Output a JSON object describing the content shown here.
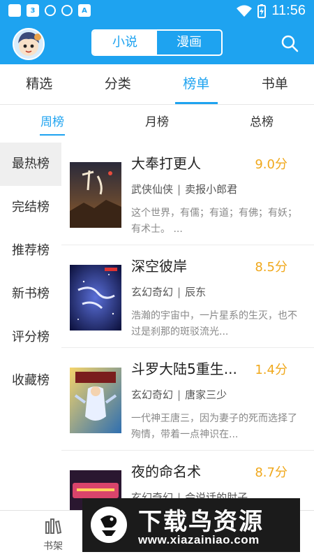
{
  "status_bar": {
    "time": "11:56",
    "icons": [
      "app-icon",
      "network-3g-icon",
      "shield-icon",
      "shield-check-icon",
      "font-a-icon",
      "wifi-icon",
      "battery-charging-icon"
    ]
  },
  "header": {
    "seg_novel": "小说",
    "seg_comic": "漫画",
    "active_segment": "小说"
  },
  "categories": [
    "精选",
    "分类",
    "榜单",
    "书单"
  ],
  "active_category": "榜单",
  "periods": [
    "周榜",
    "月榜",
    "总榜"
  ],
  "active_period": "周榜",
  "ranks": [
    "最热榜",
    "完结榜",
    "推荐榜",
    "新书榜",
    "评分榜",
    "收藏榜"
  ],
  "active_rank": "最热榜",
  "books": [
    {
      "title": "大奉打更人",
      "score": "9.0分",
      "genre": "武侠仙侠",
      "author": "卖报小郎君",
      "desc": "这个世界，有儒；有道；有佛；有妖；有术士。 ..."
    },
    {
      "title": "深空彼岸",
      "score": "8.5分",
      "genre": "玄幻奇幻",
      "author": "辰东",
      "desc": "浩瀚的宇宙中，一片星系的生灭，也不过是刹那的斑驳流光..."
    },
    {
      "title": "斗罗大陆5重生...",
      "score": "1.4分",
      "genre": "玄幻奇幻",
      "author": "唐家三少",
      "desc": "一代神王唐三，因为妻子的死而选择了殉情，带着一点神识在..."
    },
    {
      "title": "夜的命名术",
      "score": "8.7分",
      "genre": "玄幻奇幻",
      "author": "会说话的肘子",
      "desc": ""
    }
  ],
  "separator": "|",
  "bottom_nav": {
    "shelf_label": "书架"
  },
  "watermark": {
    "cn": "下载鸟资源",
    "url": "www.xiazainiao.com"
  },
  "colors": {
    "primary": "#1ea3f0",
    "score": "#f0a81c",
    "active_rank_bg": "#efefef"
  }
}
